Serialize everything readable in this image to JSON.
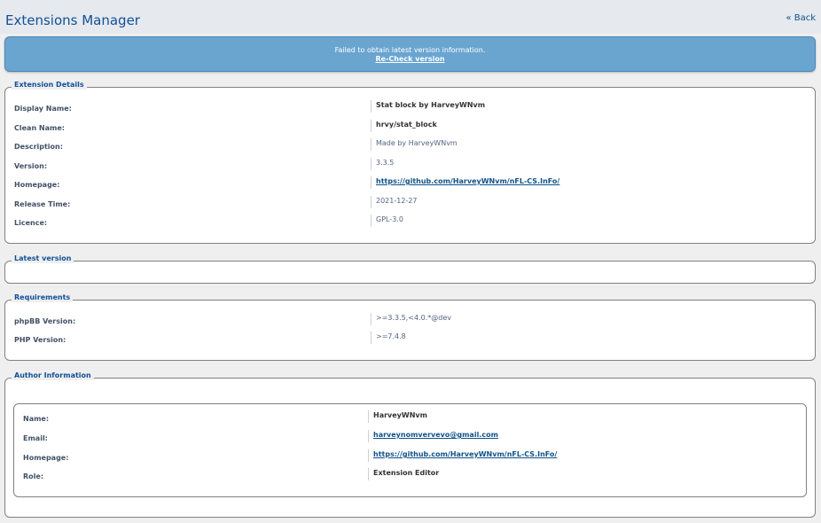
{
  "header": {
    "title": "Extensions Manager",
    "back_label": "« Back"
  },
  "notice": {
    "message": "Failed to obtain latest version information.",
    "recheck_label": "Re-Check version"
  },
  "extension_details": {
    "legend": "Extension Details",
    "rows": [
      {
        "label": "Display Name:",
        "value": "Stat block by HarveyWNvm"
      },
      {
        "label": "Clean Name:",
        "value": "hrvy/stat_block"
      },
      {
        "label": "Description:",
        "value": "Made by HarveyWNvm"
      },
      {
        "label": "Version:",
        "value": "3.3.5"
      },
      {
        "label": "Homepage:",
        "value": "https://github.com/HarveyWNvm/nFL-CS.InFo/"
      },
      {
        "label": "Release Time:",
        "value": "2021-12-27"
      },
      {
        "label": "Licence:",
        "value": "GPL-3.0"
      }
    ]
  },
  "latest_version": {
    "legend": "Latest version"
  },
  "requirements": {
    "legend": "Requirements",
    "rows": [
      {
        "label": "phpBB Version:",
        "value": ">=3.3.5,<4.0.*@dev"
      },
      {
        "label": "PHP Version:",
        "value": ">=7.4.8"
      }
    ]
  },
  "author": {
    "legend": "Author Information",
    "rows": [
      {
        "label": "Name:",
        "value": "HarveyWNvm"
      },
      {
        "label": "Email:",
        "value": "harveynomvervevo@gmail.com"
      },
      {
        "label": "Homepage:",
        "value": "https://github.com/HarveyWNvm/nFL-CS.InFo/"
      },
      {
        "label": "Role:",
        "value": "Extension Editor"
      }
    ]
  },
  "colors": {
    "accent": "#115098",
    "notice_bg": "#6aa5d0",
    "page_bg": "#efefef"
  }
}
